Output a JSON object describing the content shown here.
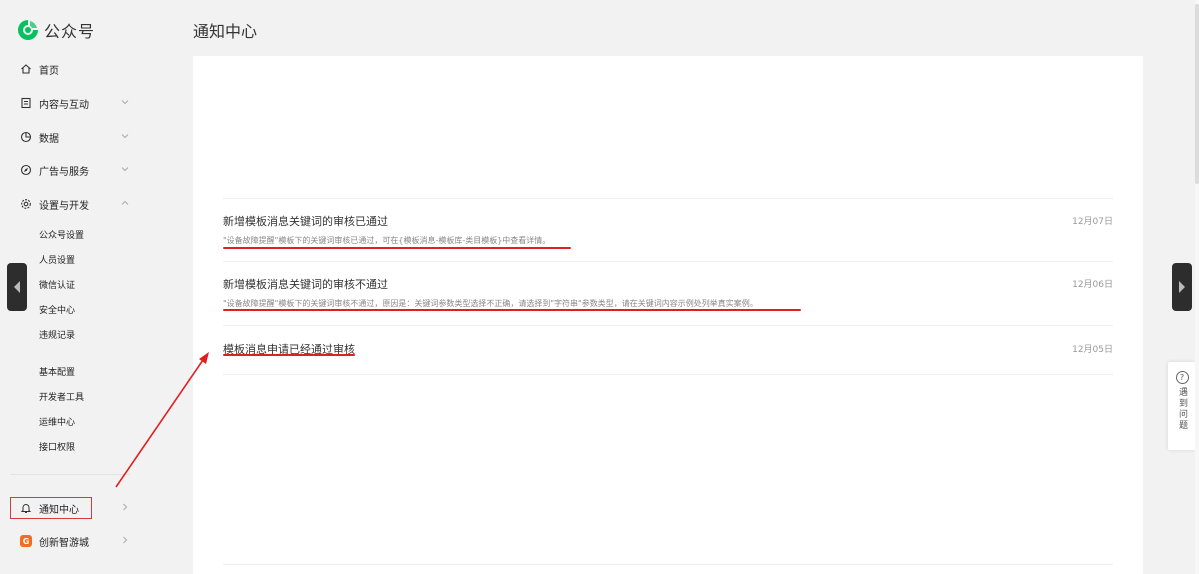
{
  "brand": {
    "name": "公众号",
    "accent": "#07c160"
  },
  "sidebar": {
    "items": [
      {
        "label": "首页",
        "icon": "home-icon"
      },
      {
        "label": "内容与互动",
        "icon": "document-icon"
      },
      {
        "label": "数据",
        "icon": "pie-chart-icon"
      },
      {
        "label": "广告与服务",
        "icon": "compass-icon"
      },
      {
        "label": "设置与开发",
        "icon": "gear-icon"
      }
    ],
    "sub_items": [
      "公众号设置",
      "人员设置",
      "微信认证",
      "安全中心",
      "违规记录",
      "基本配置",
      "开发者工具",
      "运维中心",
      "接口权限"
    ],
    "notify": {
      "label": "通知中心",
      "icon": "bell-icon"
    },
    "games": {
      "label": "创新智游城",
      "icon": "game-badge-icon",
      "badge": "G"
    }
  },
  "header": {
    "title": "通知中心"
  },
  "notifications": [
    {
      "title": "新增模板消息关键词的审核已通过",
      "desc": "\"设备故障提醒\"模板下的关键词审核已通过，可在{模板消息-模板库-类目模板}中查看详情。",
      "date": "12月07日"
    },
    {
      "title": "新增模板消息关键词的审核不通过",
      "desc": "\"设备故障提醒\"模板下的关键词审核不通过，原因是：关键词参数类型选择不正确，请选择到\"字符串\"参数类型，请在关键词内容示例处列举真实案例。",
      "date": "12月06日"
    },
    {
      "title": "模板消息申请已经通过审核",
      "desc": "",
      "date": "12月05日"
    }
  ],
  "help": {
    "label": "遇到问题",
    "icon_text": "?"
  },
  "annotation_color": "#e02020"
}
